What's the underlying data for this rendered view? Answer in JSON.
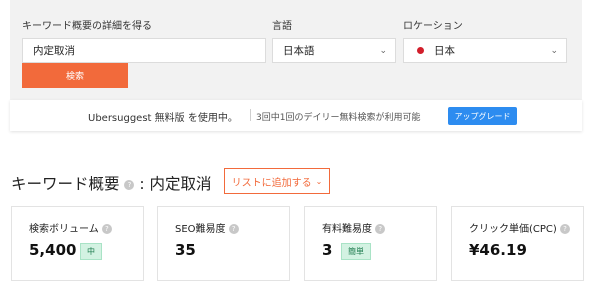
{
  "form": {
    "keyword_label": "キーワード概要の詳細を得る",
    "keyword_value": "内定取消",
    "language_label": "言語",
    "language_value": "日本語",
    "location_label": "ロケーション",
    "location_value": "日本",
    "search_button": "検索"
  },
  "banner": {
    "plan_text": "Ubersuggest 無料版 を使用中。",
    "usage_text": "3回中1回のデイリー無料検索が利用可能",
    "upgrade_button": "アップグレード"
  },
  "overview": {
    "title_prefix": "キーワード概要",
    "title_suffix": ": 内定取消",
    "add_list_button": "リストに追加する"
  },
  "metrics": [
    {
      "label": "検索ボリューム",
      "value": "5,400",
      "badge": "中"
    },
    {
      "label": "SEO難易度",
      "value": "35"
    },
    {
      "label": "有料難易度",
      "value": "3",
      "badge": "簡単"
    },
    {
      "label": "クリック単価(CPC)",
      "value": "¥46.19"
    }
  ],
  "colors": {
    "accent": "#f26a3b",
    "upgrade": "#2d8cf0",
    "badge_bg": "#d3f2e2"
  },
  "icons": [
    "help-icon",
    "chevron-down-icon",
    "japan-flag-icon"
  ]
}
